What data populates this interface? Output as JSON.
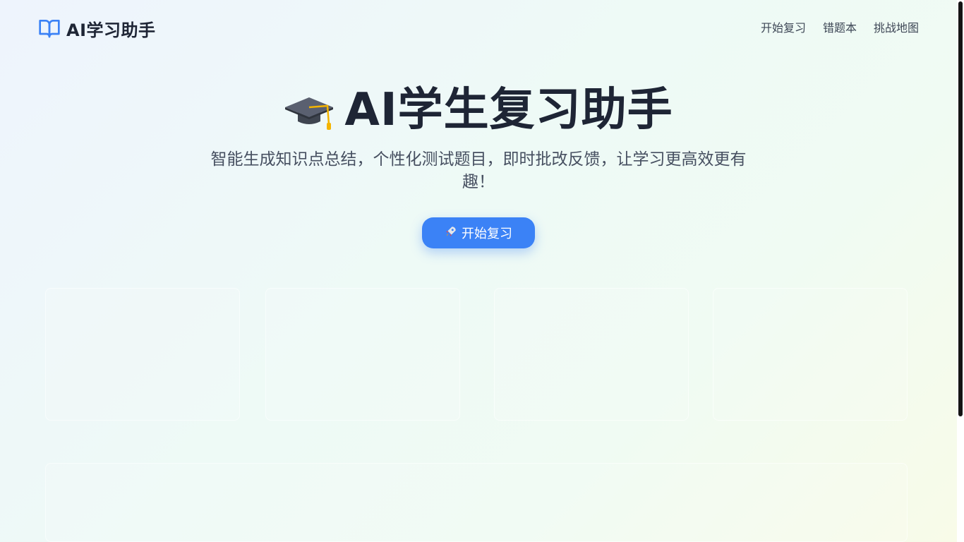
{
  "brand": {
    "name": "AI学习助手",
    "icon": "book-open-icon",
    "color": "#3b82f6"
  },
  "nav": {
    "items": [
      "开始复习",
      "错题本",
      "挑战地图"
    ]
  },
  "hero": {
    "icon": "graduation-cap-icon",
    "title": "AI学生复习助手",
    "subtitle": "智能生成知识点总结，个性化测试题目，即时批改反馈，让学习更高效更有趣！",
    "cta": {
      "icon": "rocket-icon",
      "label": "开始复习"
    }
  },
  "colors": {
    "accent": "#3b82f6",
    "text": "#1e2535",
    "muted": "#475061"
  }
}
